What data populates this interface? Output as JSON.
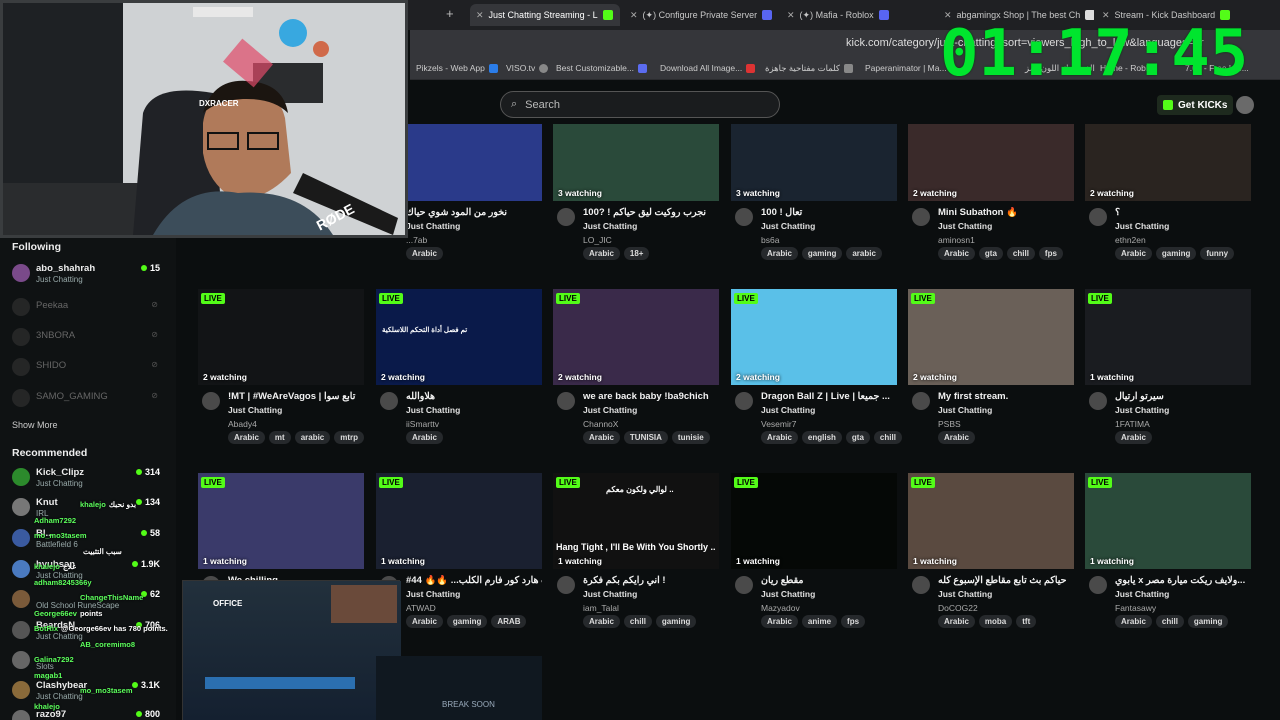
{
  "browser": {
    "tabs": [
      {
        "label": "Just Chatting Streaming - L",
        "active": true
      },
      {
        "label": "(✦) Configure Private Server"
      },
      {
        "label": "(✦) Mafia - Roblox"
      },
      {
        "label": "abgamingx Shop | The best Ch"
      },
      {
        "label": "Stream - Kick Dashboard"
      }
    ],
    "url": "kick.com/category/just-chatting?sort=viewers_high_to_low&languages=ar",
    "bookmarks": [
      "Pikzels - Web App",
      "VISO.tv",
      "Best Customizable...",
      "Download All Image...",
      "كلمات مفتاحية جاهزة",
      "Paperanimator | Ma...",
      "الفيسبوك اللون رمز",
      "Home - Roblox",
      "7.00 - Free Uni..."
    ]
  },
  "overlay": {
    "clock": "01:17:45",
    "mic_brand": "RØDE",
    "chair_brand": "DXRACER",
    "chat_lines": [
      {
        "name": "khalejo",
        "text": "بدو نحبك"
      },
      {
        "name": "Adham7292",
        "text": ""
      },
      {
        "name": "mo_mo3tasem",
        "text": ""
      },
      {
        "name": "",
        "text": "سبب التثبيت"
      },
      {
        "name": "khalejo",
        "text": "علاج"
      },
      {
        "name": "adham8245366y",
        "text": ""
      },
      {
        "name": "ChangeThisName",
        "text": ""
      },
      {
        "name": "George66ev",
        "text": "points"
      },
      {
        "name": "BotRix",
        "text": "@George66ev has 780 points."
      },
      {
        "name": "AB_coremimo8",
        "text": ""
      },
      {
        "name": "Galina7292",
        "text": ""
      },
      {
        "name": "magab1",
        "text": ""
      },
      {
        "name": "mo_mo3tasem",
        "text": ""
      },
      {
        "name": "khalejo",
        "text": ""
      }
    ],
    "small_stream_text": "OFFICE",
    "bottom_thumb_text": "BREAK SOON"
  },
  "header": {
    "search_placeholder": "Search",
    "get_kicks": "Get KICKs"
  },
  "sidebar": {
    "following_title": "Following",
    "following": [
      {
        "name": "abo_shahrah",
        "category": "Just Chatting",
        "viewers": "15",
        "live": true
      },
      {
        "name": "Peekaa",
        "live": false
      },
      {
        "name": "3NBORA",
        "live": false
      },
      {
        "name": "SHIDO",
        "live": false
      },
      {
        "name": "SAMO_GAMING",
        "live": false
      }
    ],
    "show_more": "Show More",
    "recommended_title": "Recommended",
    "recommended": [
      {
        "name": "Kick_Clipz",
        "category": "Just Chatting",
        "viewers": "314"
      },
      {
        "name": "Knut",
        "category": "IRL",
        "viewers": "134"
      },
      {
        "name": "Bl...",
        "category": "Battlefield 6",
        "viewers": "58"
      },
      {
        "name": "hyubsan",
        "category": "Just Chatting",
        "viewers": "1.9K"
      },
      {
        "name": "",
        "category": "Old School RuneScape",
        "viewers": "62"
      },
      {
        "name": "BeardsN",
        "category": "Just Chatting",
        "viewers": "706"
      },
      {
        "name": "",
        "category": "Slots",
        "viewers": ""
      },
      {
        "name": "Clashybear",
        "category": "Just Chatting",
        "viewers": "3.1K"
      },
      {
        "name": "razo97",
        "category": "",
        "viewers": "800"
      }
    ]
  },
  "streams": [
    {
      "row": 0,
      "col": 1,
      "live": false,
      "watching": "",
      "title": "",
      "category": "",
      "user": "",
      "tags": []
    },
    {
      "row": 0,
      "col": 2,
      "live": false,
      "watching": "hing",
      "title": "نخور من المود شوي حياك",
      "category": "Just Chatting",
      "user": "...7ab",
      "tags": [
        "Arabic"
      ]
    },
    {
      "row": 0,
      "col": 3,
      "live": false,
      "watching": "3 watching",
      "title": "100? ! نجرب روكيت ليق حياكم",
      "category": "Just Chatting",
      "user": "LO_JIC",
      "tags": [
        "Arabic",
        "18+"
      ]
    },
    {
      "row": 0,
      "col": 4,
      "live": false,
      "watching": "3 watching",
      "title": "100 ! تعال",
      "category": "Just Chatting",
      "user": "bs6a",
      "tags": [
        "Arabic",
        "gaming",
        "arabic"
      ]
    },
    {
      "row": 0,
      "col": 5,
      "live": false,
      "watching": "2 watching",
      "title": "Mini Subathon 🔥",
      "category": "Just Chatting",
      "user": "aminosn1",
      "tags": [
        "Arabic",
        "gta",
        "chill",
        "fps"
      ]
    },
    {
      "row": 0,
      "col": 6,
      "live": false,
      "watching": "2 watching",
      "title": "؟",
      "category": "Just Chatting",
      "user": "ethn2en",
      "tags": [
        "Arabic",
        "gaming",
        "funny"
      ]
    },
    {
      "row": 1,
      "col": 1,
      "live": true,
      "watching": "2 watching",
      "title": "!MT | #WeAreVagos | تابع سوا",
      "category": "Just Chatting",
      "user": "Abady4",
      "tags": [
        "Arabic",
        "mt",
        "arabic",
        "mtrp"
      ]
    },
    {
      "row": 1,
      "col": 2,
      "live": true,
      "watching": "2 watching",
      "title": "هلاوالله",
      "category": "Just Chatting",
      "user": "iiSmarttv",
      "tags": [
        "Arabic"
      ]
    },
    {
      "row": 1,
      "col": 3,
      "live": true,
      "watching": "2 watching",
      "title": "we are back baby !ba9chich",
      "category": "Just Chatting",
      "user": "ChannoX",
      "tags": [
        "Arabic",
        "TUNISIA",
        "tunisie"
      ]
    },
    {
      "row": 1,
      "col": 4,
      "live": true,
      "watching": "2 watching",
      "title": "Dragon Ball Z | Live | جميعا ...",
      "category": "Just Chatting",
      "user": "Vesemir7",
      "tags": [
        "Arabic",
        "english",
        "gta",
        "chill"
      ]
    },
    {
      "row": 1,
      "col": 5,
      "live": true,
      "watching": "2 watching",
      "title": "My first stream.",
      "category": "Just Chatting",
      "user": "PSBS",
      "tags": [
        "Arabic"
      ]
    },
    {
      "row": 1,
      "col": 6,
      "live": true,
      "watching": "1 watching",
      "title": "سيرتو ارتيال",
      "category": "Just Chatting",
      "user": "1FATIMA",
      "tags": [
        "Arabic"
      ]
    },
    {
      "row": 2,
      "col": 1,
      "live": true,
      "watching": "1 watching",
      "title": "We chilling",
      "category": "",
      "user": "",
      "tags": []
    },
    {
      "row": 2,
      "col": 2,
      "live": true,
      "watching": "1 watching",
      "title": "#44 🔥🔥 ...ث هارد كور فارم الكلب",
      "category": "Just Chatting",
      "user": "ATWAD",
      "tags": [
        "Arabic",
        "gaming",
        "ARAB"
      ]
    },
    {
      "row": 2,
      "col": 3,
      "live": true,
      "watching": "1 watching",
      "title": "اني رايكم بكم فكرة !",
      "category": "Just Chatting",
      "user": "iam_Talal",
      "tags": [
        "Arabic",
        "chill",
        "gaming"
      ]
    },
    {
      "row": 2,
      "col": 4,
      "live": true,
      "watching": "1 watching",
      "title": "مقطع ريان",
      "category": "Just Chatting",
      "user": "Mazyadov",
      "tags": [
        "Arabic",
        "anime",
        "fps"
      ]
    },
    {
      "row": 2,
      "col": 5,
      "live": true,
      "watching": "1 watching",
      "title": "حياكم بث تابع مقاطع الإسبوع كله",
      "category": "Just Chatting",
      "user": "DoCOG22",
      "tags": [
        "Arabic",
        "moba",
        "tft"
      ]
    },
    {
      "row": 2,
      "col": 6,
      "live": true,
      "watching": "1 watching",
      "title": "يابوي x ولايف ريكت ميارة مصر...",
      "category": "Just Chatting",
      "user": "Fantasawy",
      "tags": [
        "Arabic",
        "chill",
        "gaming"
      ]
    }
  ],
  "thumb_texts": {
    "r1c2": "تم فصل أداة التحكم اللاسلكية",
    "r2c3a": "لوالي ولكون معكم ..",
    "r2c3b": "Hang Tight , I'll Be With You Shortly .."
  },
  "colors": {
    "accent": "#53fc18",
    "clock": "#00e52e"
  }
}
